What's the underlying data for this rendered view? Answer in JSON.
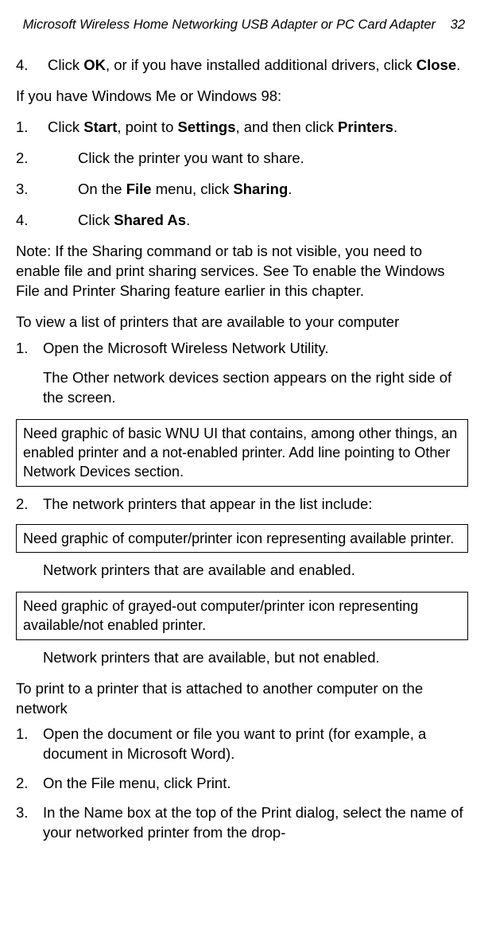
{
  "header": {
    "title": "Microsoft Wireless Home Networking USB Adapter or PC Card Adapter",
    "page": "32"
  },
  "s1": {
    "n4": "4.",
    "t4a": "Click ",
    "t4b": "OK",
    "t4c": ", or if you have installed additional drivers, click ",
    "t4d": "Close",
    "t4e": "."
  },
  "intro98": "If you have Windows Me or Windows 98:",
  "s2": {
    "n1": "1.",
    "t1a": "Click ",
    "t1b": "Start",
    "t1c": ", point to ",
    "t1d": "Settings",
    "t1e": ", and then click ",
    "t1f": "Printers",
    "t1g": ".",
    "n2": "2.",
    "t2": "Click the printer you want to share.",
    "n3": "3.",
    "t3a": "On the ",
    "t3b": "File",
    "t3c": " menu, click ",
    "t3d": "Sharing",
    "t3e": ".",
    "n4": "4.",
    "t4a": "Click ",
    "t4b": "Shared As",
    "t4c": "."
  },
  "note": "Note: If the Sharing command or tab is not visible, you need to enable file and print sharing services. See To enable the Windows File and Printer Sharing feature earlier in this chapter.",
  "viewHead": "To view a list of printers that are available to your computer",
  "v": {
    "n1": "1.",
    "t1": "Open the Microsoft Wireless Network Utility.",
    "sub1a": "The Other network devices ",
    "sub1b": "section appears on the right side of the screen.",
    "box1": "Need graphic of basic WNU UI that contains, among other things, an enabled printer and a not-enabled printer. Add line pointing to Other Network Devices section.",
    "n2": "2.",
    "t2": "The network printers that appear in the list include:",
    "box2": "Need graphic of computer/printer icon representing available printer.",
    "sub2a": "Network printers that are available and enabled.",
    "box3": "Need graphic of grayed-out computer/printer icon representing available/not enabled printer.",
    "sub2b": "Network printers that are available, but not enabled."
  },
  "printHead": "To print to a printer that is attached to another computer on the network",
  "p": {
    "n1": "1.",
    "t1": "Open the document or file you want to print (for example, a document in Microsoft Word).",
    "n2": "2.",
    "t2": "On the File menu, click Print.",
    "n3": "3.",
    "t3": "In the Name box at the top of the Print dialog, select the name of your networked printer from the drop-"
  }
}
